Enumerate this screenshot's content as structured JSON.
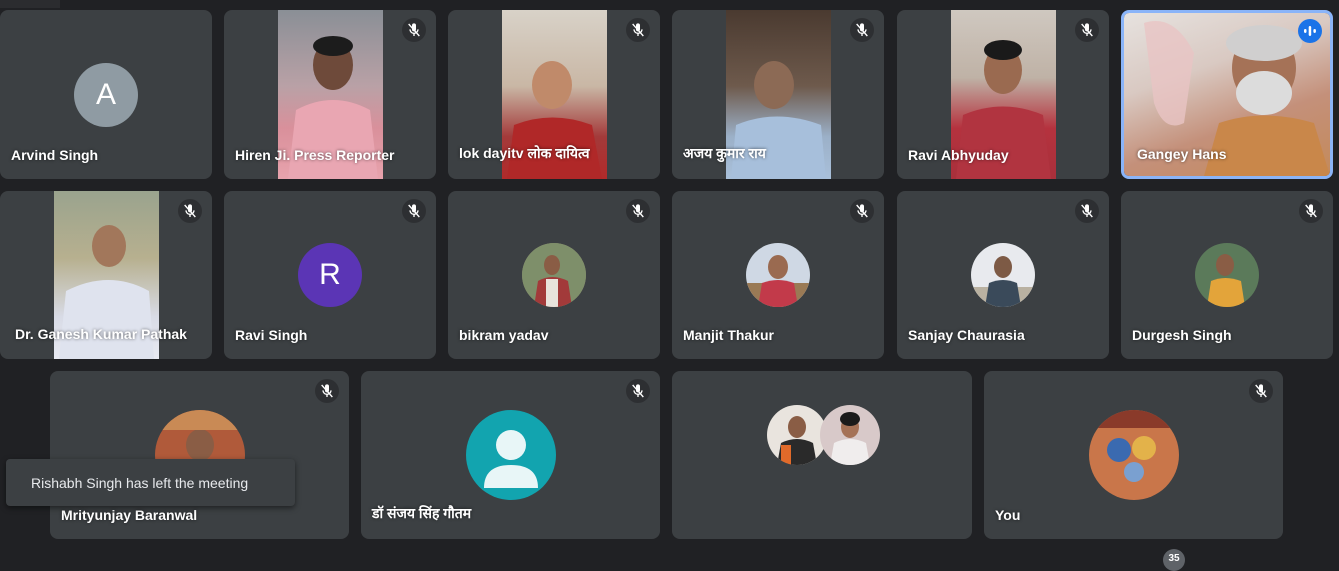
{
  "participants": {
    "p1": {
      "name": "Arvind Singh",
      "initial": "A",
      "avatar_color": "#8f9ba3"
    },
    "p2": {
      "name": "Hiren Ji. Press Reporter"
    },
    "p3": {
      "name": "lok dayitv लोक दायित्व"
    },
    "p4": {
      "name": "अजय कुमार राय"
    },
    "p5": {
      "name": "Ravi Abhyuday"
    },
    "p6": {
      "name": "Gangey Hans"
    },
    "p7": {
      "name": "Dr. Ganesh Kumar Pathak"
    },
    "p8": {
      "name": "Ravi Singh",
      "initial": "R",
      "avatar_color": "#5b35b5"
    },
    "p9": {
      "name": "bikram yadav"
    },
    "p10": {
      "name": "Manjit Thakur"
    },
    "p11": {
      "name": "Sanjay Chaurasia"
    },
    "p12": {
      "name": "Durgesh Singh"
    },
    "p13": {
      "name": "Mrityunjay Baranwal"
    },
    "p14": {
      "name": "डॉ संजय सिंह गौतम",
      "avatar_color": "#12a4af"
    },
    "p15": {
      "name": ""
    },
    "p16": {
      "name": "You"
    }
  },
  "toast": {
    "text": "Rishabh Singh has left the meeting"
  },
  "participant_count": "35",
  "colors": {
    "background": "#202124",
    "tile": "#3c4043",
    "speaking_border": "#8ab4f8",
    "speaking_badge": "#1a73e8"
  },
  "icons": {
    "mute": "mic-off-icon",
    "speaking": "audio-level-icon",
    "default_avatar": "person-icon"
  }
}
